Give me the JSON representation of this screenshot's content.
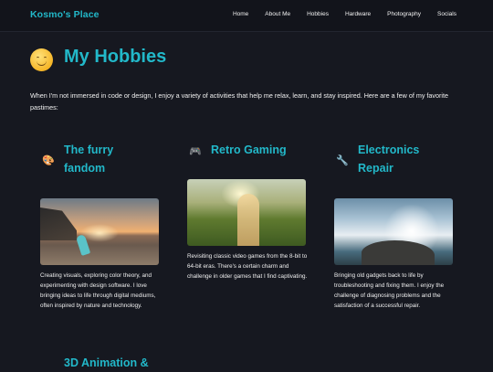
{
  "header": {
    "brand": "Kosmo's Place",
    "nav": [
      "Home",
      "About Me",
      "Hobbies",
      "Hardware",
      "Photography",
      "Socials"
    ]
  },
  "hero": {
    "emoji_icon": "smiling-face-icon",
    "title": "My Hobbies",
    "intro": "When I'm not immersed in code or design, I enjoy a variety of activities that help me relax, learn, and stay inspired. Here are a few of my favorite pastimes:"
  },
  "cards": [
    {
      "icon": "palette-icon",
      "title": "The furry fandom",
      "text": "Creating visuals, exploring color theory, and experimenting with design software. I love bringing ideas to life through digital mediums, often inspired by nature and technology."
    },
    {
      "icon": "game-controller-icon",
      "title": "Retro Gaming",
      "text": "Revisiting classic video games from the 8-bit to 64-bit eras. There's a certain charm and challenge in older games that I find captivating."
    },
    {
      "icon": "wrench-icon",
      "title": "Electronics Repair",
      "text": "Bringing old gadgets back to life by troubleshooting and fixing them. I enjoy the challenge of diagnosing problems and the satisfaction of a successful repair."
    },
    {
      "title": "3D Animation &"
    }
  ],
  "colors": {
    "accent": "#22b8c9",
    "background": "#161820",
    "header_bg": "#12141b"
  }
}
